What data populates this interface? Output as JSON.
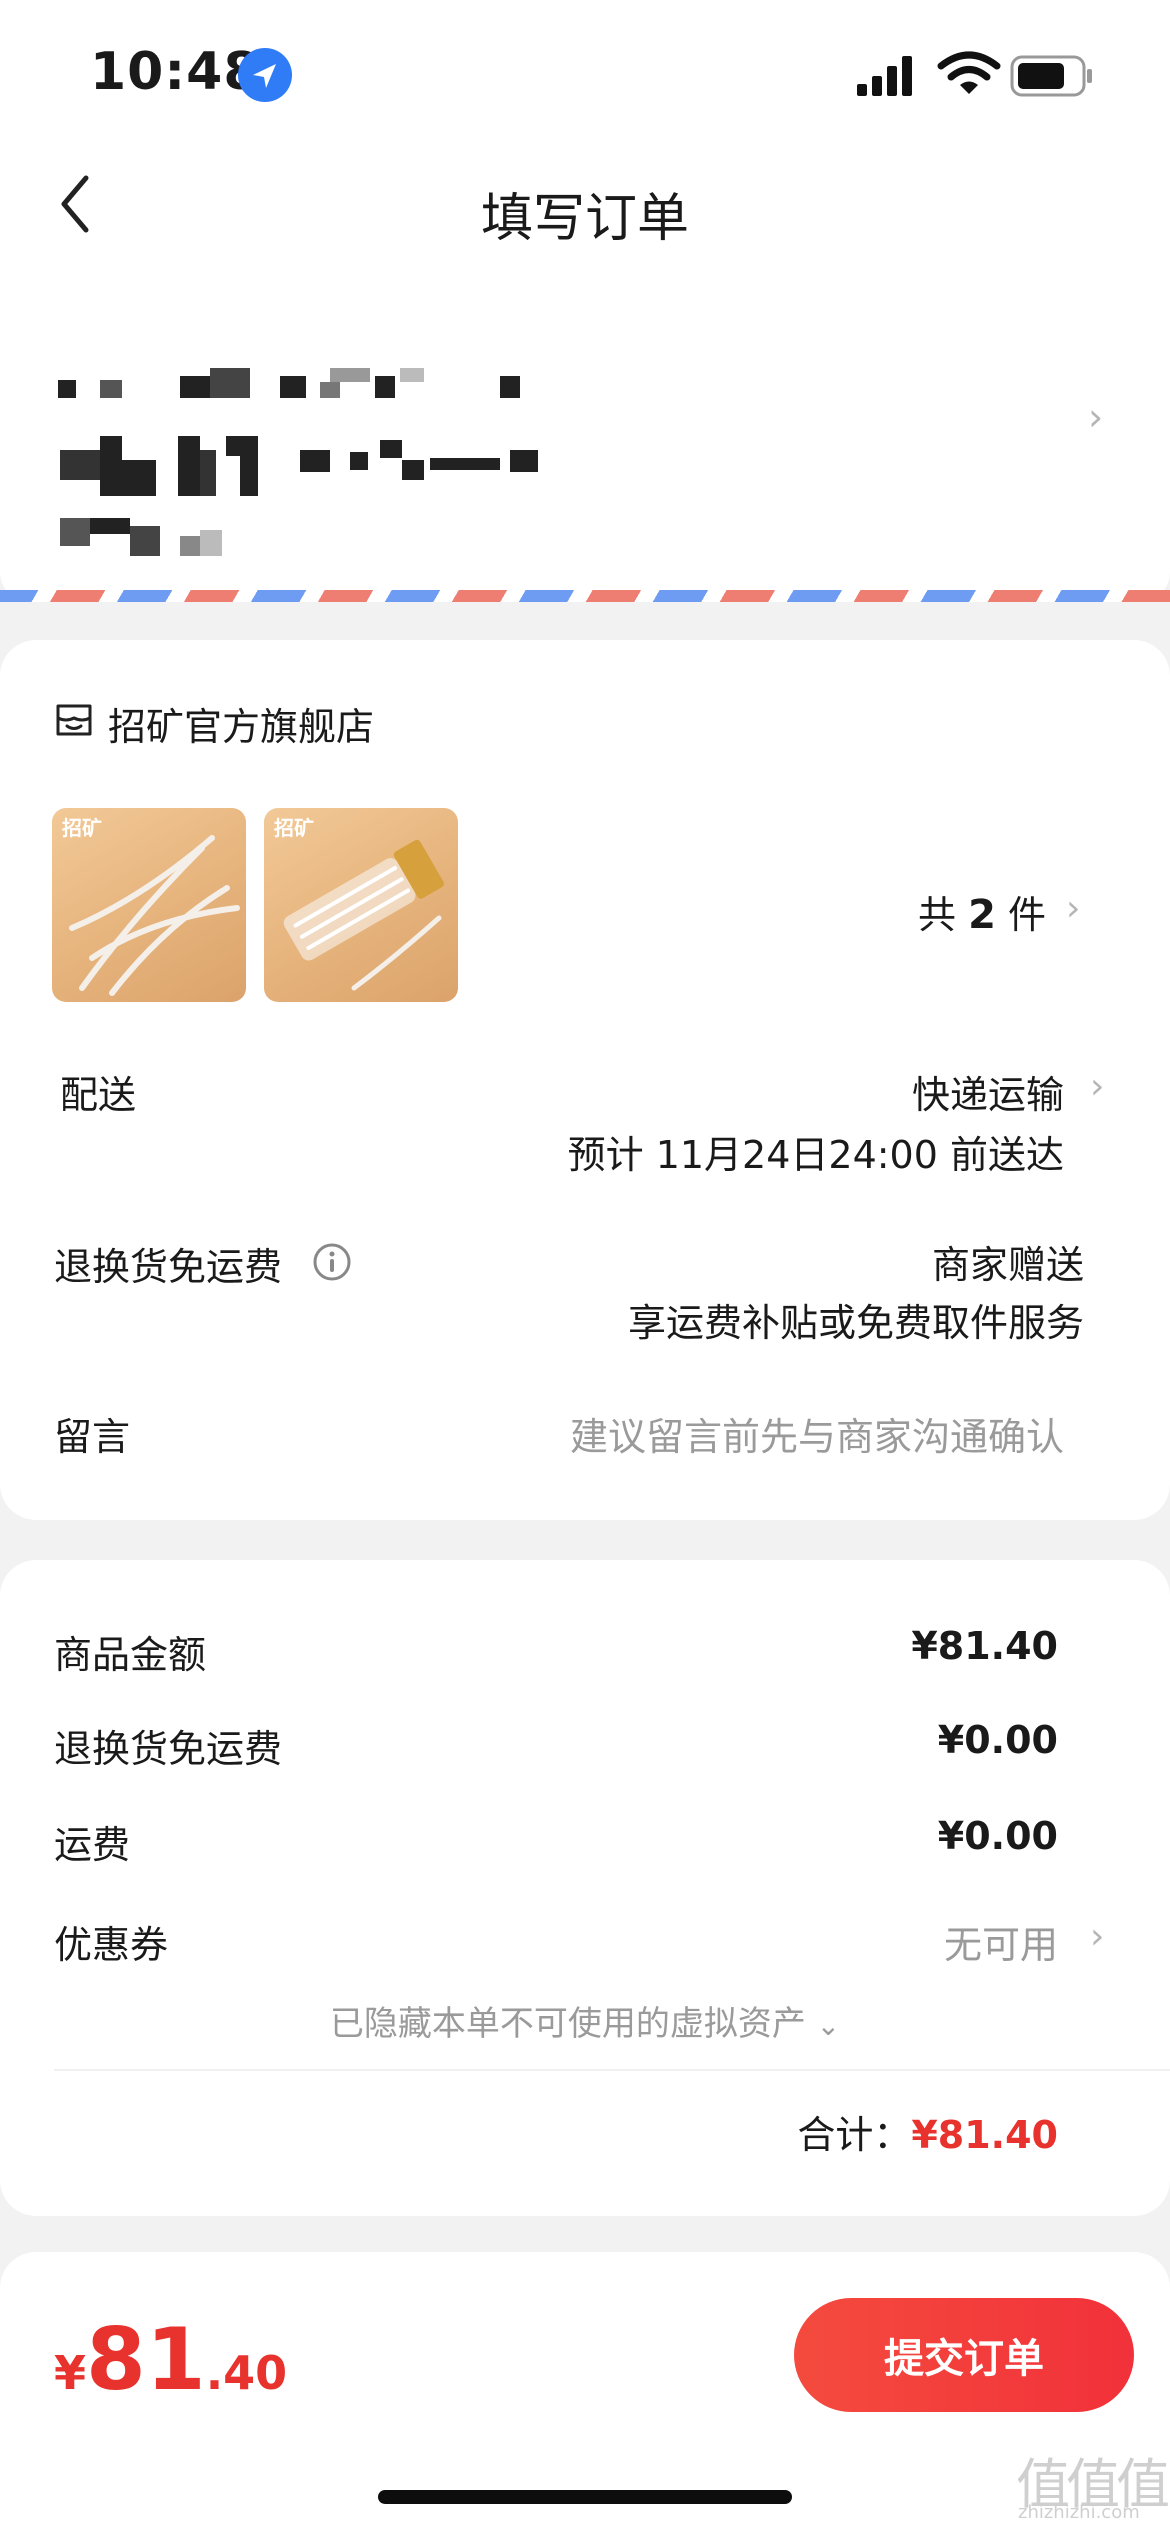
{
  "status_bar": {
    "time": "10:48"
  },
  "header": {
    "title": "填写订单"
  },
  "shop": {
    "name": "招矿官方旗舰店",
    "thumb_logo": "招矿",
    "count_prefix": "共",
    "count": "2",
    "count_suffix": "件"
  },
  "delivery": {
    "label": "配送",
    "method": "快递运输",
    "eta": "预计 11月24日24:00 前送达"
  },
  "return_insurance": {
    "label": "退换货免运费",
    "value": "商家赠送",
    "desc": "享运费补贴或免费取件服务"
  },
  "message": {
    "label": "留言",
    "placeholder": "建议留言前先与商家沟通确认"
  },
  "pricing": {
    "goods_label": "商品金额",
    "goods_value": "¥81.40",
    "return_label": "退换货免运费",
    "return_value": "¥0.00",
    "shipping_label": "运费",
    "shipping_value": "¥0.00",
    "coupon_label": "优惠券",
    "coupon_value": "无可用",
    "hidden_assets": "已隐藏本单不可使用的虚拟资产",
    "total_label": "合计：",
    "total_value": "¥81.40"
  },
  "bottom": {
    "currency": "¥",
    "price_int": "81",
    "price_dec": ".40",
    "submit_label": "提交订单"
  },
  "watermark": {
    "logo": "值值值",
    "site": "zhizhizhi.com"
  },
  "colors": {
    "accent_red": "#e8322e",
    "location_blue": "#2f7cf6",
    "airmail_red": "#ee7d72",
    "airmail_blue": "#6f9cf3"
  }
}
